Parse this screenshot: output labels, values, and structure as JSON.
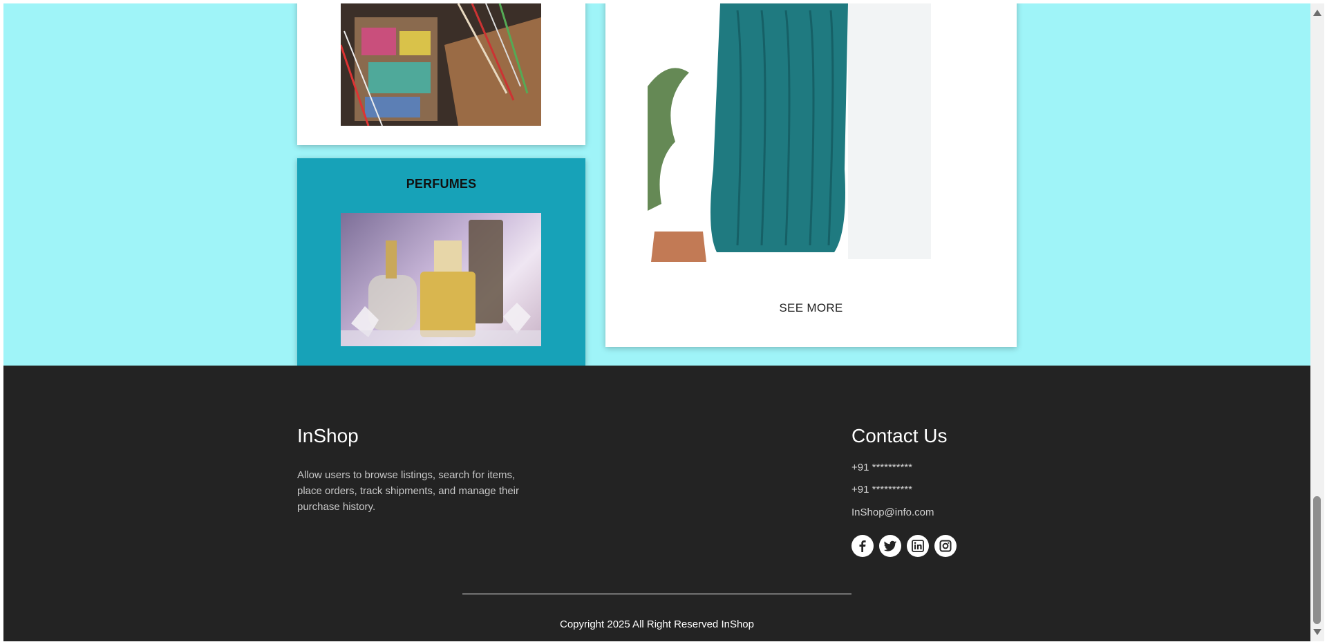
{
  "cards": {
    "perfumes_title": "PERFUMES",
    "see_more_label": "SEE MORE"
  },
  "footer": {
    "brand": "InShop",
    "description": "Allow users to browse listings, search for items, place orders, track shipments, and manage their purchase history.",
    "contact_title": "Contact Us",
    "phone_1": "+91 **********",
    "phone_2": "+91 **********",
    "email": "InShop@info.com",
    "social": [
      "facebook-icon",
      "twitter-icon",
      "linkedin-icon",
      "instagram-icon"
    ],
    "copyright": "Copyright 2025 All Right Reserved InShop"
  },
  "colors": {
    "page_background": "#9ff4f8",
    "perfume_card": "#17a2b8",
    "footer_background": "#232323"
  }
}
